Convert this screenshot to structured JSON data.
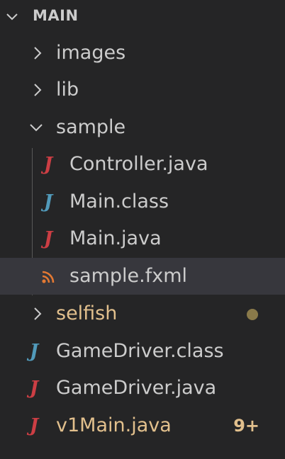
{
  "explorer": {
    "section_title": "MAIN",
    "items": [
      {
        "label": "images"
      },
      {
        "label": "lib"
      },
      {
        "label": "sample"
      },
      {
        "label": "Controller.java",
        "icon": "J"
      },
      {
        "label": "Main.class",
        "icon": "J"
      },
      {
        "label": "Main.java",
        "icon": "J"
      },
      {
        "label": "sample.fxml"
      },
      {
        "label": "selfish"
      },
      {
        "label": "GameDriver.class",
        "icon": "J"
      },
      {
        "label": "GameDriver.java",
        "icon": "J"
      },
      {
        "label": "v1Main.java",
        "icon": "J",
        "badge": "9+"
      }
    ]
  },
  "colors": {
    "background": "#252526",
    "selected_row": "#37373d",
    "text": "#cccccc",
    "modified_text": "#e2c08d",
    "java_icon": "#cc3e44",
    "class_icon": "#519aba",
    "rss_icon": "#e37933",
    "modified_dot": "#8a7a4a"
  }
}
